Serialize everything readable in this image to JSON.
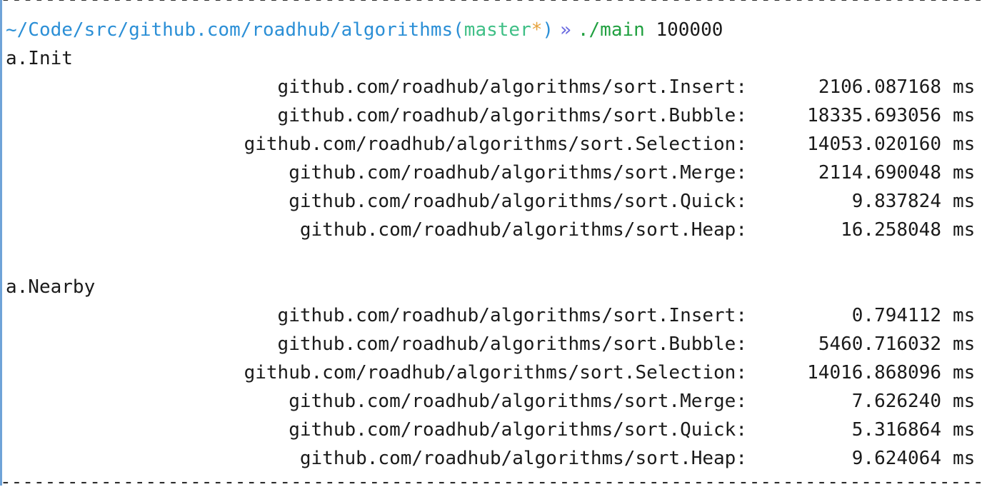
{
  "terminal": {
    "top_rule": "--------------------------------------------------------------------------------------------------------------",
    "bottom_rule": "--------------------------------------------------------------------------------------------------------------",
    "prompt": {
      "path": "~/Code/src/github.com/roadhub/algorithms",
      "paren_open": "(",
      "branch": "master",
      "dirty_marker": "*",
      "paren_close": ")",
      "arrow": "»",
      "command": "./main",
      "argument": "100000"
    },
    "sections": [
      {
        "title": "a.Init",
        "rows": [
          {
            "name": "github.com/roadhub/algorithms/sort.Insert:",
            "value": "2106.087168",
            "unit": "ms"
          },
          {
            "name": "github.com/roadhub/algorithms/sort.Bubble:",
            "value": "18335.693056",
            "unit": "ms"
          },
          {
            "name": "github.com/roadhub/algorithms/sort.Selection:",
            "value": "14053.020160",
            "unit": "ms"
          },
          {
            "name": "github.com/roadhub/algorithms/sort.Merge:",
            "value": "2114.690048",
            "unit": "ms"
          },
          {
            "name": "github.com/roadhub/algorithms/sort.Quick:",
            "value": "9.837824",
            "unit": "ms"
          },
          {
            "name": "github.com/roadhub/algorithms/sort.Heap:",
            "value": "16.258048",
            "unit": "ms"
          }
        ]
      },
      {
        "title": "a.Nearby",
        "rows": [
          {
            "name": "github.com/roadhub/algorithms/sort.Insert:",
            "value": "0.794112",
            "unit": "ms"
          },
          {
            "name": "github.com/roadhub/algorithms/sort.Bubble:",
            "value": "5460.716032",
            "unit": "ms"
          },
          {
            "name": "github.com/roadhub/algorithms/sort.Selection:",
            "value": "14016.868096",
            "unit": "ms"
          },
          {
            "name": "github.com/roadhub/algorithms/sort.Merge:",
            "value": "7.626240",
            "unit": "ms"
          },
          {
            "name": "github.com/roadhub/algorithms/sort.Quick:",
            "value": "5.316864",
            "unit": "ms"
          },
          {
            "name": "github.com/roadhub/algorithms/sort.Heap:",
            "value": "9.624064",
            "unit": "ms"
          }
        ]
      }
    ]
  }
}
